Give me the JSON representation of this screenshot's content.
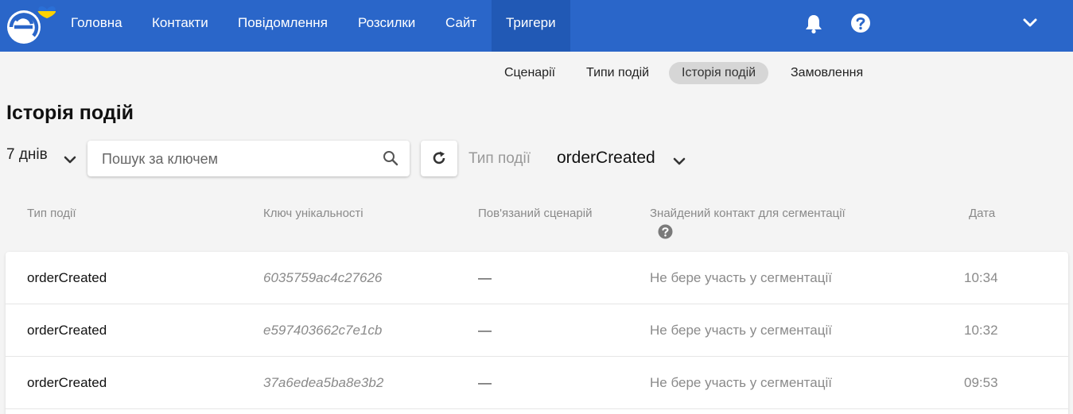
{
  "topnav": {
    "items": [
      {
        "label": "Головна"
      },
      {
        "label": "Контакти"
      },
      {
        "label": "Повідомлення"
      },
      {
        "label": "Розсилки"
      },
      {
        "label": "Сайт"
      },
      {
        "label": "Тригери",
        "active": true
      }
    ],
    "icons": [
      "bell-icon",
      "help-icon",
      "chevron-down-icon"
    ],
    "brand_colors": {
      "bar": "#2a66c9",
      "active": "#2159b5",
      "flag_blue": "#2a6fd6",
      "flag_yellow": "#ffd200"
    }
  },
  "subnav": {
    "tabs": [
      {
        "label": "Сценарії"
      },
      {
        "label": "Типи подій"
      },
      {
        "label": "Історія подій",
        "active": true
      },
      {
        "label": "Замовлення"
      }
    ]
  },
  "page": {
    "title": "Історія подій"
  },
  "filters": {
    "period": "7 днів",
    "search_placeholder": "Пошук за ключем",
    "event_type_label": "Тип події",
    "event_type_value": "orderCreated"
  },
  "table": {
    "headers": {
      "type": "Тип події",
      "key": "Ключ унікальності",
      "scenario": "Пов'язаний сценарій",
      "contact": "Знайдений контакт для сегментації",
      "date": "Дата"
    },
    "rows": [
      {
        "type": "orderCreated",
        "key": "6035759ac4c27626",
        "scenario": "—",
        "contact": "Не бере участь у сегментації",
        "date": "10:34"
      },
      {
        "type": "orderCreated",
        "key": "e597403662c7e1cb",
        "scenario": "—",
        "contact": "Не бере участь у сегментації",
        "date": "10:32"
      },
      {
        "type": "orderCreated",
        "key": "37a6edea5ba8e3b2",
        "scenario": "—",
        "contact": "Не бере участь у сегментації",
        "date": "09:53"
      }
    ]
  }
}
